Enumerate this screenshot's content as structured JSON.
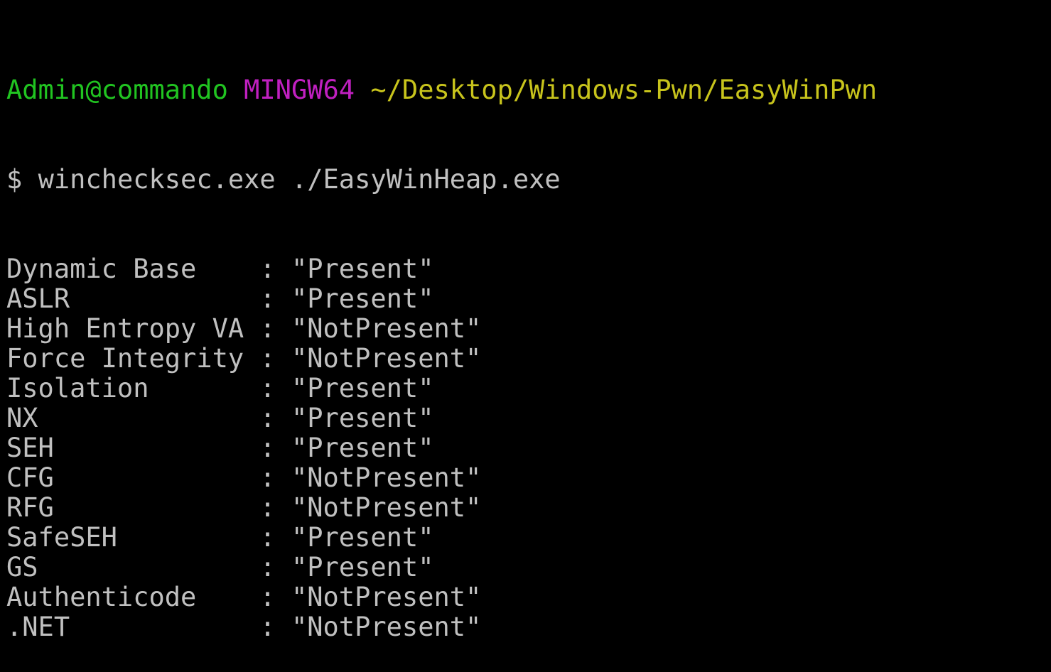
{
  "prompt": {
    "user_host": "Admin@commando",
    "system": "MINGW64",
    "path": "~/Desktop/Windows-Pwn/EasyWinPwn",
    "colors": {
      "user_host": "#21c421",
      "system": "#c020c0",
      "path": "#c8c41c"
    }
  },
  "command": {
    "symbol": "$",
    "text": "winchecksec.exe ./EasyWinHeap.exe"
  },
  "results": [
    {
      "name": "Dynamic Base",
      "value": "\"Present\""
    },
    {
      "name": "ASLR",
      "value": "\"Present\""
    },
    {
      "name": "High Entropy VA",
      "value": "\"NotPresent\""
    },
    {
      "name": "Force Integrity",
      "value": "\"NotPresent\""
    },
    {
      "name": "Isolation",
      "value": "\"Present\""
    },
    {
      "name": "NX",
      "value": "\"Present\""
    },
    {
      "name": "SEH",
      "value": "\"Present\""
    },
    {
      "name": "CFG",
      "value": "\"NotPresent\""
    },
    {
      "name": "RFG",
      "value": "\"NotPresent\""
    },
    {
      "name": "SafeSEH",
      "value": "\"Present\""
    },
    {
      "name": "GS",
      "value": "\"Present\""
    },
    {
      "name": "Authenticode",
      "value": "\"NotPresent\""
    },
    {
      "name": ".NET",
      "value": "\"NotPresent\""
    }
  ],
  "separator": ":"
}
